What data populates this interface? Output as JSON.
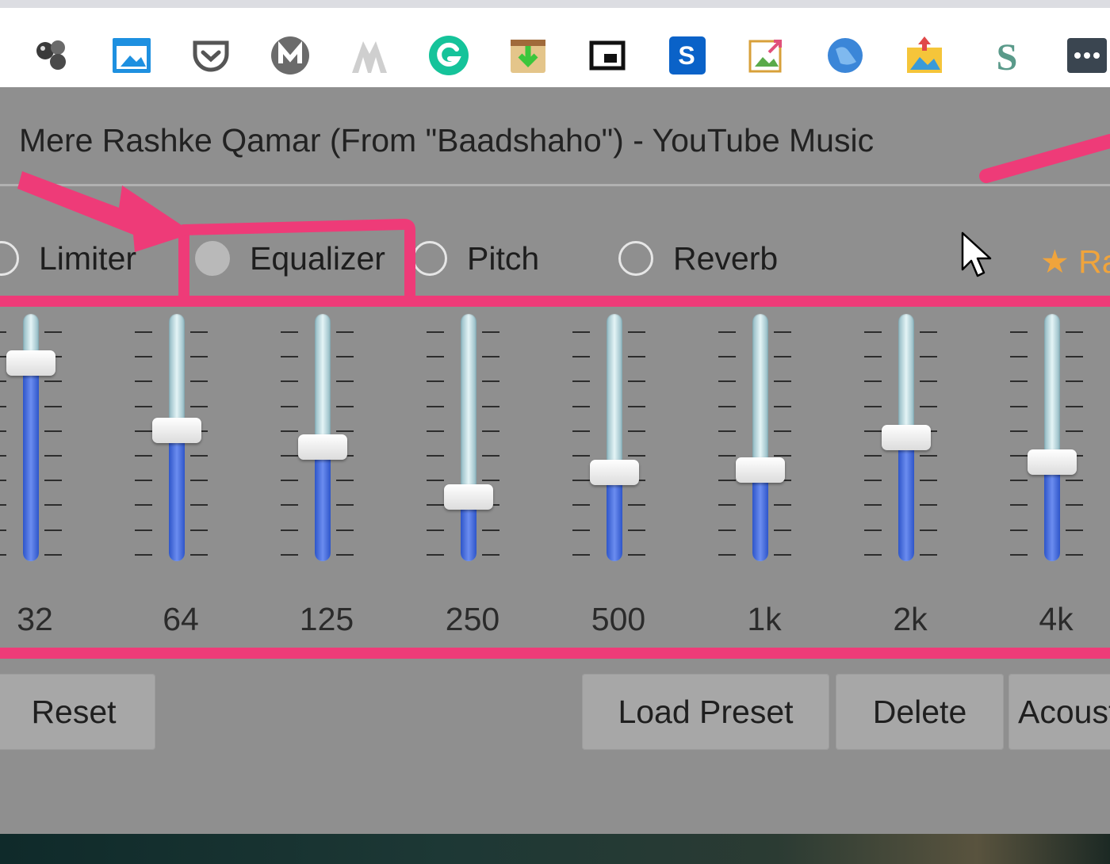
{
  "toolbar": {
    "extensions": [
      {
        "icon": "orbs-icon"
      },
      {
        "icon": "window-screenshot-icon"
      },
      {
        "icon": "pocket-icon"
      },
      {
        "icon": "mega-m-icon"
      },
      {
        "icon": "mountain-logo-icon"
      },
      {
        "icon": "grammarly-icon"
      },
      {
        "icon": "download-box-icon"
      },
      {
        "icon": "picture-in-picture-icon"
      },
      {
        "icon": "blue-s-icon"
      },
      {
        "icon": "image-export-icon"
      },
      {
        "icon": "globe-icon"
      },
      {
        "icon": "photo-upload-icon"
      },
      {
        "icon": "stylish-s-icon"
      },
      {
        "icon": "more-dots-icon"
      }
    ]
  },
  "panel": {
    "tab_title": "Mere Rashke Qamar (From \"Baadshaho\") - YouTube Music",
    "modes": [
      {
        "label": "Limiter",
        "selected": false
      },
      {
        "label": "Equalizer",
        "selected": true
      },
      {
        "label": "Pitch",
        "selected": false
      },
      {
        "label": "Reverb",
        "selected": false
      }
    ],
    "rate_link": "★ Ra",
    "equalizer": {
      "bands": [
        {
          "label": "32",
          "level": 0.8
        },
        {
          "label": "64",
          "level": 0.53
        },
        {
          "label": "125",
          "level": 0.46
        },
        {
          "label": "250",
          "level": 0.26
        },
        {
          "label": "500",
          "level": 0.36
        },
        {
          "label": "1k",
          "level": 0.37
        },
        {
          "label": "2k",
          "level": 0.5
        },
        {
          "label": "4k",
          "level": 0.4
        }
      ]
    },
    "buttons": {
      "reset": "Reset",
      "load_preset": "Load Preset",
      "delete": "Delete",
      "acoustic": "Acoust"
    }
  },
  "annotation_color": "#ee3b78"
}
